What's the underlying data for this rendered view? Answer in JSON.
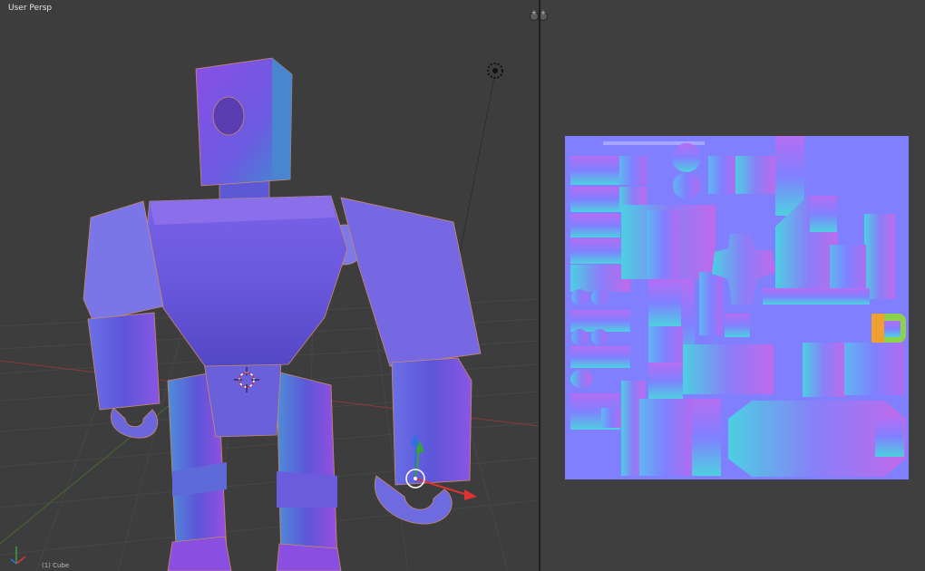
{
  "viewport": {
    "label": "User Persp",
    "footer": "(1) Cube"
  },
  "uv_editor": {
    "texture_type": "normal map"
  },
  "colors": {
    "bg": "#3d3d3d",
    "grid": "#464646",
    "x_axis": "#8a3a3a",
    "y_axis": "#4a6a2e",
    "normal_base": "#8080ff",
    "selection": "#e89a5a"
  }
}
